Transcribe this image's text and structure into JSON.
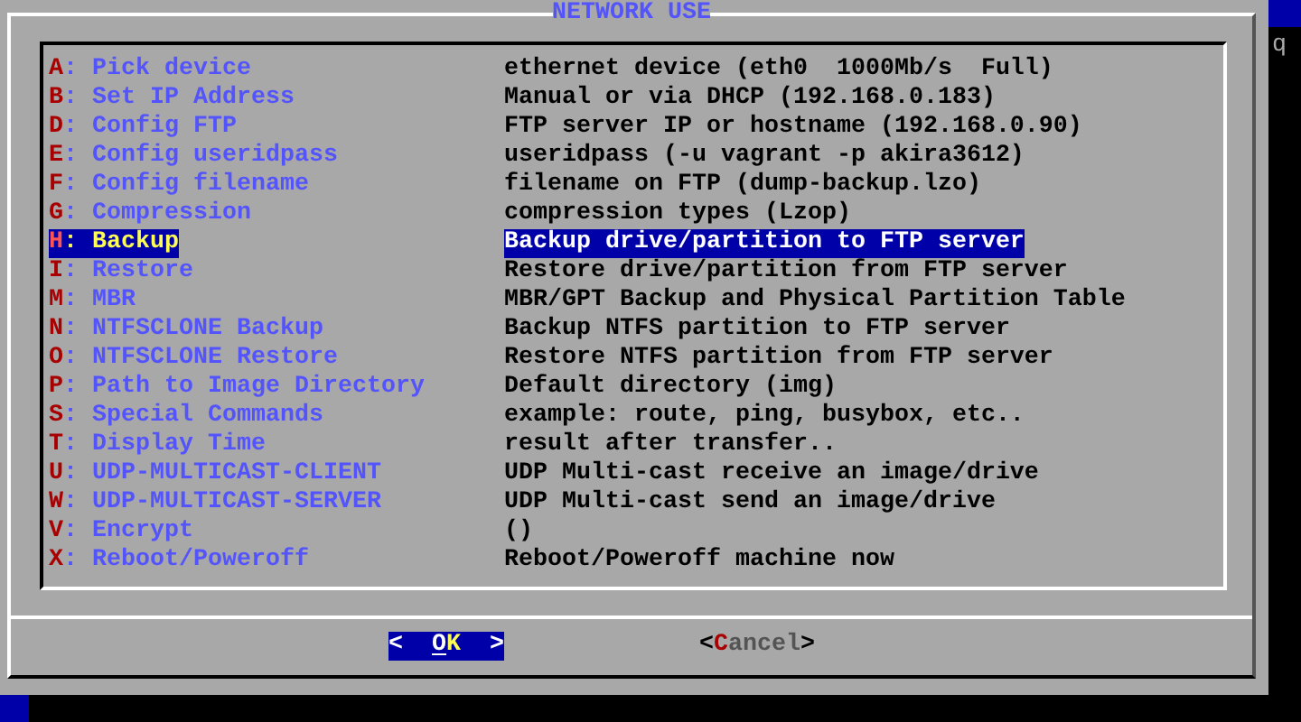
{
  "dialog": {
    "title": "NETWORK USE",
    "items": [
      {
        "key": "A",
        "sep": ":",
        "label": "Pick device",
        "description": "ethernet device (eth0  1000Mb/s  Full)",
        "selected": false
      },
      {
        "key": "B",
        "sep": ":",
        "label": "Set IP Address",
        "description": "Manual or via DHCP (192.168.0.183)",
        "selected": false
      },
      {
        "key": "D",
        "sep": ":",
        "label": "Config FTP",
        "description": "FTP server IP or hostname (192.168.0.90)",
        "selected": false
      },
      {
        "key": "E",
        "sep": ":",
        "label": "Config useridpass",
        "description": "useridpass (-u vagrant -p akira3612)",
        "selected": false
      },
      {
        "key": "F",
        "sep": ":",
        "label": "Config filename",
        "description": "filename on FTP (dump-backup.lzo)",
        "selected": false
      },
      {
        "key": "G",
        "sep": ":",
        "label": "Compression",
        "description": "compression types (Lzop)",
        "selected": false
      },
      {
        "key": "H",
        "sep": ":",
        "label": "Backup",
        "description": "Backup drive/partition to FTP server",
        "selected": true
      },
      {
        "key": "I",
        "sep": ":",
        "label": "Restore",
        "description": "Restore drive/partition from FTP server",
        "selected": false
      },
      {
        "key": "M",
        "sep": ":",
        "label": "MBR",
        "description": "MBR/GPT Backup and Physical Partition Table",
        "selected": false
      },
      {
        "key": "N",
        "sep": ":",
        "label": "NTFSCLONE Backup",
        "description": "Backup NTFS partition to FTP server",
        "selected": false
      },
      {
        "key": "O",
        "sep": ":",
        "label": "NTFSCLONE Restore",
        "description": "Restore NTFS partition from FTP server",
        "selected": false
      },
      {
        "key": "P",
        "sep": ":",
        "label": "Path to Image Directory",
        "description": "Default directory (img)",
        "selected": false
      },
      {
        "key": "S",
        "sep": ":",
        "label": "Special Commands",
        "description": "example: route, ping, busybox, etc..",
        "selected": false
      },
      {
        "key": "T",
        "sep": ":",
        "label": "Display Time",
        "description": "result after transfer..",
        "selected": false
      },
      {
        "key": "U",
        "sep": ":",
        "label": "UDP-MULTICAST-CLIENT",
        "description": "UDP Multi-cast receive an image/drive",
        "selected": false
      },
      {
        "key": "W",
        "sep": ":",
        "label": "UDP-MULTICAST-SERVER",
        "description": "UDP Multi-cast send an image/drive",
        "selected": false
      },
      {
        "key": "V",
        "sep": ":",
        "label": "Encrypt",
        "description": "()",
        "selected": false
      },
      {
        "key": "X",
        "sep": ":",
        "label": "Reboot/Poweroff",
        "description": "Reboot/Poweroff machine now",
        "selected": false
      }
    ],
    "buttons": [
      {
        "open": "<",
        "label": "OK",
        "close": ">",
        "selected": true
      },
      {
        "open": "<",
        "label": "Cancel",
        "close": ">",
        "selected": false
      }
    ]
  },
  "side_text": "q"
}
